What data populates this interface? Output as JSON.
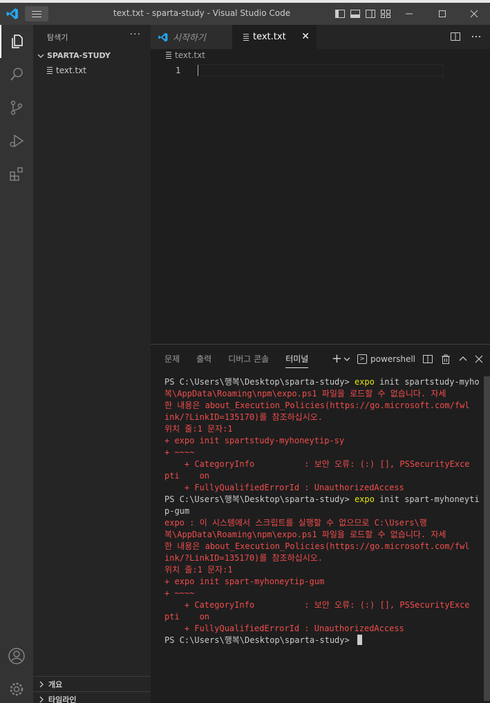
{
  "titlebar": {
    "title": "text.txt - sparta-study - Visual Studio Code",
    "minimize": "—",
    "maximize": "☐",
    "close": "✕"
  },
  "sidebar": {
    "title": "탐색기",
    "more": "···",
    "folder": "SPARTA-STUDY",
    "files": [
      "text.txt"
    ],
    "outline_label": "개요",
    "timeline_label": "타임라인"
  },
  "tabs": [
    {
      "label": "시작하기",
      "active": false
    },
    {
      "label": "text.txt",
      "active": true,
      "close": "✕"
    }
  ],
  "breadcrumb": {
    "file": "text.txt"
  },
  "editor": {
    "line_numbers": [
      "1"
    ]
  },
  "panel": {
    "tabs": [
      "문제",
      "출력",
      "디버그 콘솔",
      "터미널"
    ],
    "active_tab": "터미널",
    "add": "+",
    "shell": "powershell",
    "terminal_lines": [
      {
        "parts": [
          {
            "t": "PS C:\\Users\\행복\\Desktop\\sparta-study> ",
            "c": "white"
          },
          {
            "t": "expo",
            "c": "yellow"
          },
          {
            "t": " init spartstudy-myho",
            "c": "white"
          }
        ]
      },
      {
        "parts": [
          {
            "t": "복\\AppData\\Roaming\\npm\\expo.ps1 파일을 로드할 수 없습니다. 자세",
            "c": "red"
          }
        ]
      },
      {
        "parts": [
          {
            "t": "한 내용은 about_Execution_Policies(https://go.microsoft.com/fwl",
            "c": "red"
          }
        ]
      },
      {
        "parts": [
          {
            "t": "ink/?LinkID=135170)를 참조하십시오.",
            "c": "red"
          }
        ]
      },
      {
        "parts": [
          {
            "t": "위치 줄:1 문자:1",
            "c": "red"
          }
        ]
      },
      {
        "parts": [
          {
            "t": "+ expo init spartstudy-myhoneytip-sy",
            "c": "red"
          }
        ]
      },
      {
        "parts": [
          {
            "t": "+ ~~~~",
            "c": "red"
          }
        ]
      },
      {
        "parts": [
          {
            "t": "    + CategoryInfo          : 보안 오류: (:) [], PSSecurityExce",
            "c": "red"
          }
        ]
      },
      {
        "parts": [
          {
            "t": "pti    on",
            "c": "red"
          }
        ]
      },
      {
        "parts": [
          {
            "t": "    + FullyQualifiedErrorId : UnauthorizedAccess",
            "c": "red"
          }
        ]
      },
      {
        "parts": [
          {
            "t": "PS C:\\Users\\행복\\Desktop\\sparta-study> ",
            "c": "white"
          },
          {
            "t": "expo",
            "c": "yellow"
          },
          {
            "t": " init spart-myhoneyti",
            "c": "white"
          }
        ]
      },
      {
        "parts": [
          {
            "t": "p-gum",
            "c": "white"
          }
        ]
      },
      {
        "parts": [
          {
            "t": "expo : 이 시스템에서 스크립트를 실행할 수 없으므로 C:\\Users\\행",
            "c": "red"
          }
        ]
      },
      {
        "parts": [
          {
            "t": "복\\AppData\\Roaming\\npm\\expo.ps1 파일을 로드할 수 없습니다. 자세",
            "c": "red"
          }
        ]
      },
      {
        "parts": [
          {
            "t": "한 내용은 about_Execution_Policies(https://go.microsoft.com/fwl",
            "c": "red"
          }
        ]
      },
      {
        "parts": [
          {
            "t": "ink/?LinkID=135170)를 참조하십시오.",
            "c": "red"
          }
        ]
      },
      {
        "parts": [
          {
            "t": "위치 줄:1 문자:1",
            "c": "red"
          }
        ]
      },
      {
        "parts": [
          {
            "t": "+ expo init spart-myhoneytip-gum",
            "c": "red"
          }
        ]
      },
      {
        "parts": [
          {
            "t": "+ ~~~~",
            "c": "red"
          }
        ]
      },
      {
        "parts": [
          {
            "t": "    + CategoryInfo          : 보안 오류: (:) [], PSSecurityExce",
            "c": "red"
          }
        ]
      },
      {
        "parts": [
          {
            "t": "pti    on",
            "c": "red"
          }
        ]
      },
      {
        "parts": [
          {
            "t": "    + FullyQualifiedErrorId : UnauthorizedAccess",
            "c": "red"
          }
        ]
      },
      {
        "parts": [
          {
            "t": "PS C:\\Users\\행복\\Desktop\\sparta-study> ",
            "c": "white"
          }
        ],
        "cursor": true
      }
    ]
  },
  "colors": {
    "accent": "#007acc",
    "terminal_error": "#f14c4c",
    "terminal_command": "#e5e510"
  }
}
